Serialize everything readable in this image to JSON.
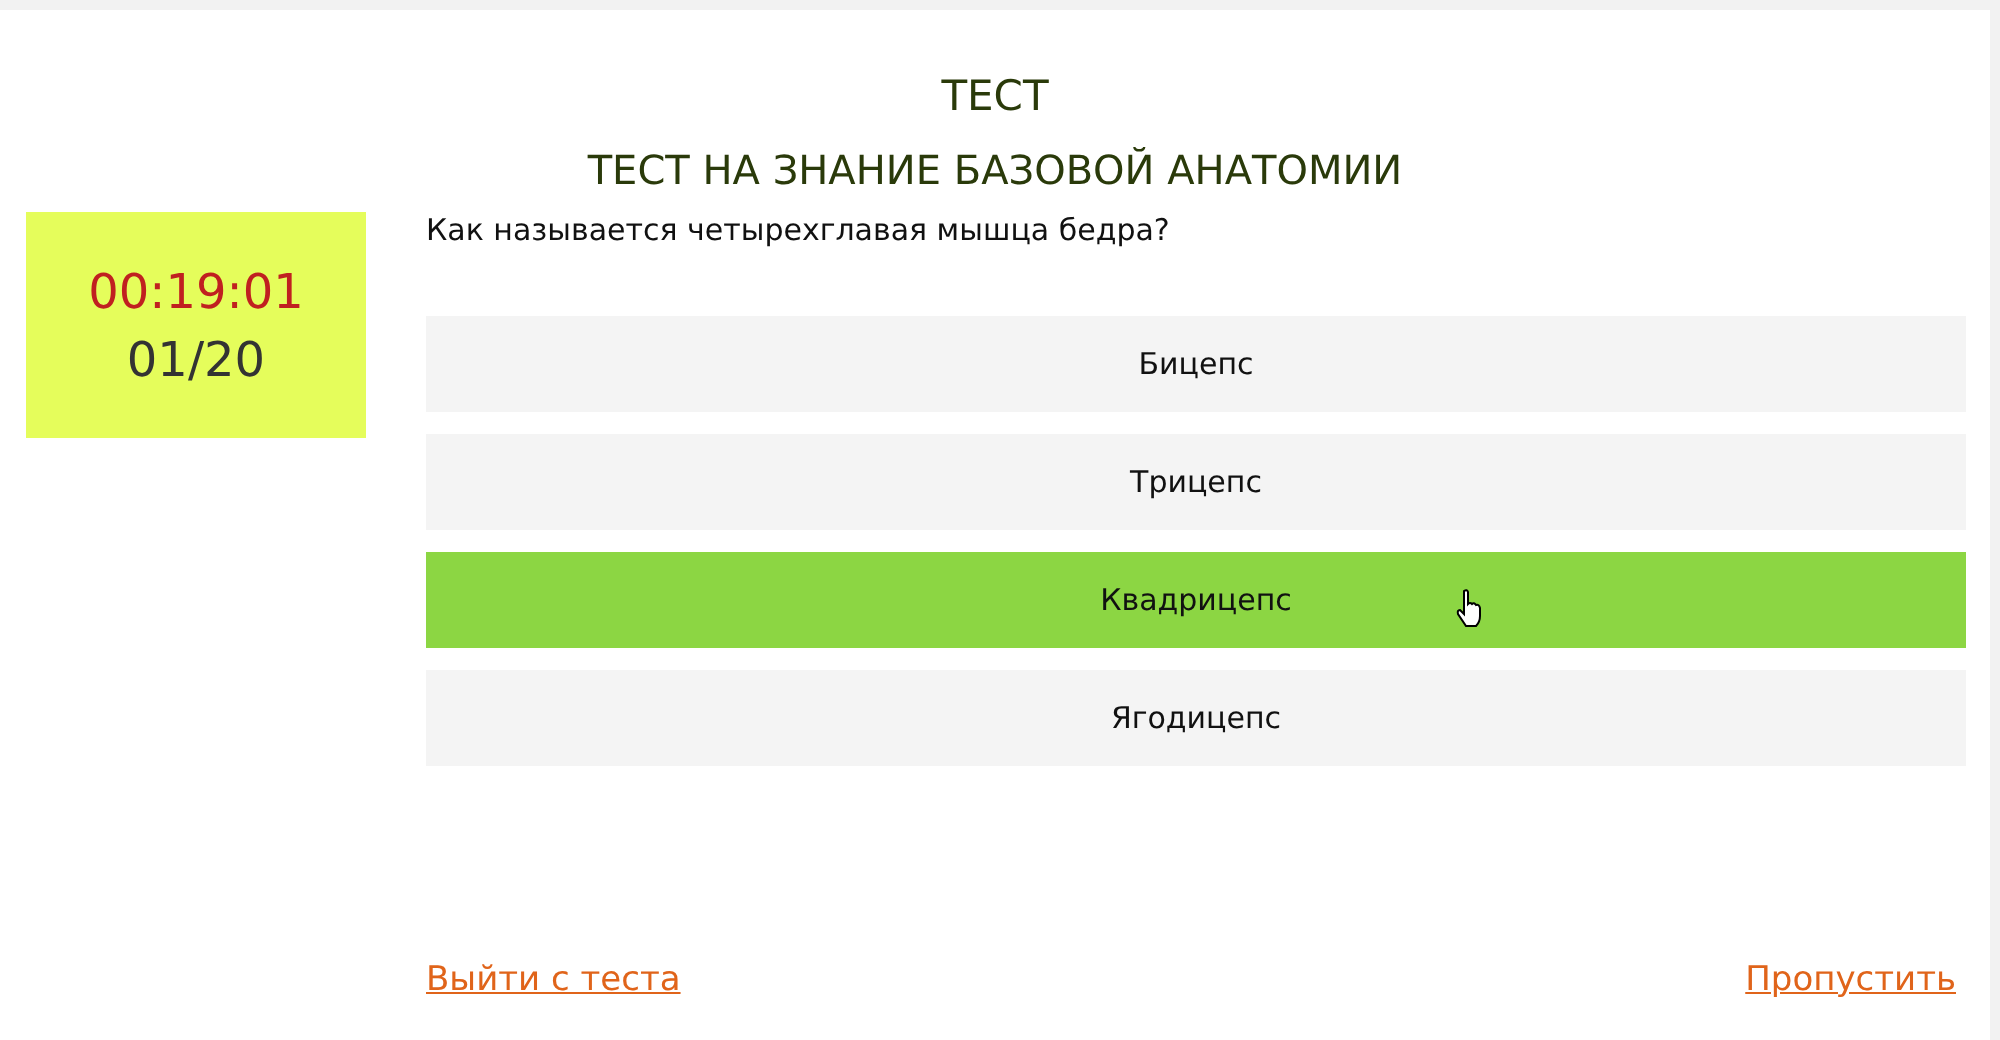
{
  "title": "ТЕСТ",
  "subtitle": "ТЕСТ НА ЗНАНИЕ БАЗОВОЙ АНАТОМИИ",
  "timer": "00:19:01",
  "progress": "01/20",
  "question": "Как называется четырехглавая мышца бедра?",
  "answers": [
    {
      "label": "Бицепс",
      "selected": false
    },
    {
      "label": "Трицепс",
      "selected": false
    },
    {
      "label": "Квадрицепс",
      "selected": true
    },
    {
      "label": "Ягодицепс",
      "selected": false
    }
  ],
  "exit_link": "Выйти с теста",
  "skip_link": "Пропустить"
}
